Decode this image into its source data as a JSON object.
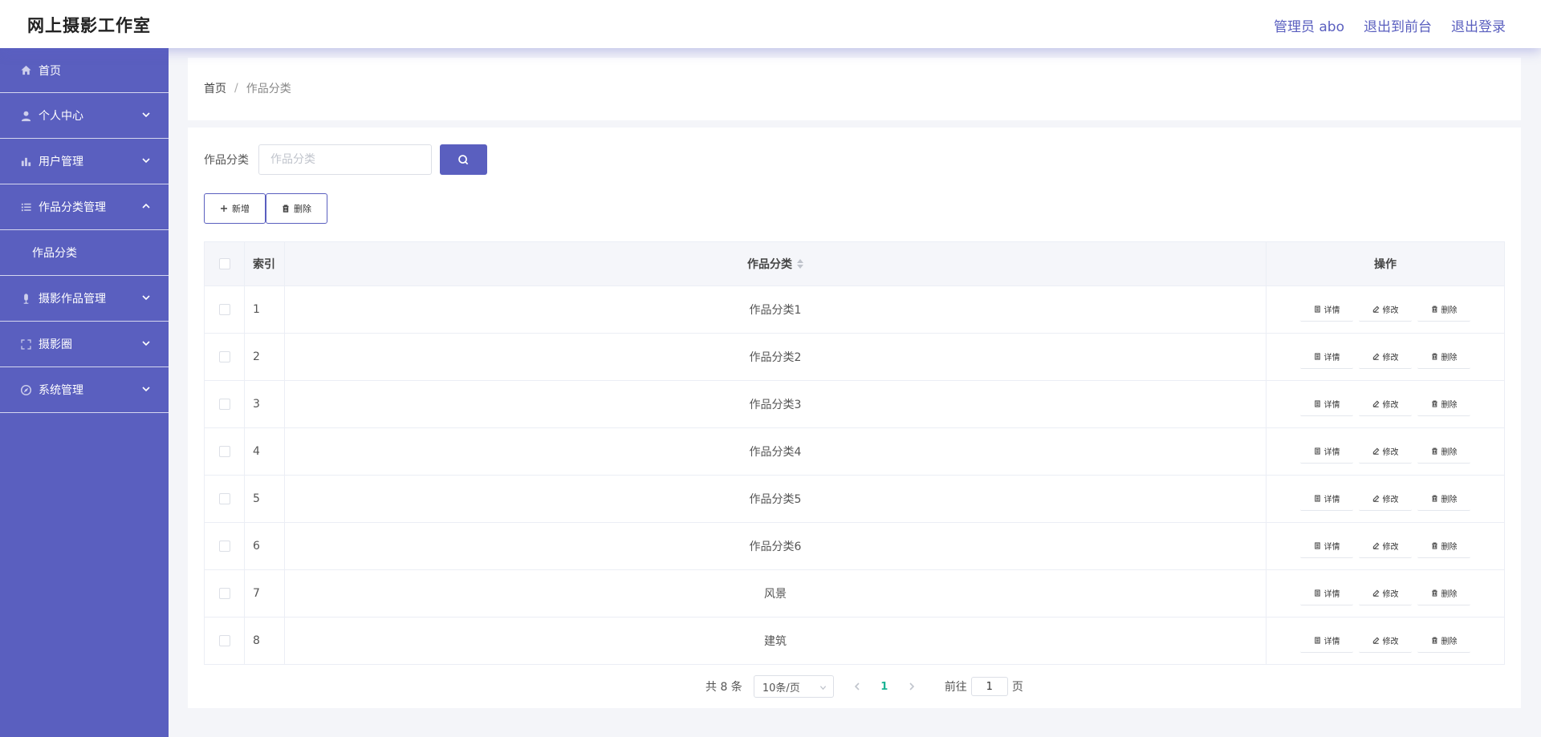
{
  "header": {
    "brand": "网上摄影工作室",
    "links": [
      "管理员 abo",
      "退出到前台",
      "退出登录"
    ]
  },
  "sidebar": {
    "items": [
      {
        "label": "首页",
        "icon": "home-icon"
      },
      {
        "label": "个人中心",
        "icon": "user-icon",
        "expanded": false
      },
      {
        "label": "用户管理",
        "icon": "bar-chart-icon",
        "expanded": false
      },
      {
        "label": "作品分类管理",
        "icon": "list-icon",
        "expanded": true,
        "children": [
          "作品分类"
        ]
      },
      {
        "label": "摄影作品管理",
        "icon": "microphone-icon",
        "expanded": false
      },
      {
        "label": "摄影圈",
        "icon": "fullscreen-icon",
        "expanded": false
      },
      {
        "label": "系统管理",
        "icon": "compass-icon",
        "expanded": false
      }
    ]
  },
  "breadcrumb": {
    "home": "首页",
    "separator": "/",
    "current": "作品分类"
  },
  "search": {
    "label": "作品分类",
    "placeholder": "作品分类",
    "value": ""
  },
  "actions": {
    "add": "新增",
    "delete": "删除"
  },
  "table": {
    "columns": [
      "索引",
      "作品分类",
      "操作"
    ],
    "op_labels": {
      "detail": "详情",
      "edit": "修改",
      "delete": "删除"
    },
    "rows": [
      {
        "index": "1",
        "name": "作品分类1"
      },
      {
        "index": "2",
        "name": "作品分类2"
      },
      {
        "index": "3",
        "name": "作品分类3"
      },
      {
        "index": "4",
        "name": "作品分类4"
      },
      {
        "index": "5",
        "name": "作品分类5"
      },
      {
        "index": "6",
        "name": "作品分类6"
      },
      {
        "index": "7",
        "name": "风景"
      },
      {
        "index": "8",
        "name": "建筑"
      }
    ]
  },
  "pagination": {
    "total": "共 8 条",
    "page_size": "10条/页",
    "current_page": "1",
    "goto_prefix": "前往",
    "goto_value": "1",
    "goto_suffix": "页"
  },
  "colors": {
    "accent": "#5a5fbf",
    "active_page": "#1ab394"
  }
}
